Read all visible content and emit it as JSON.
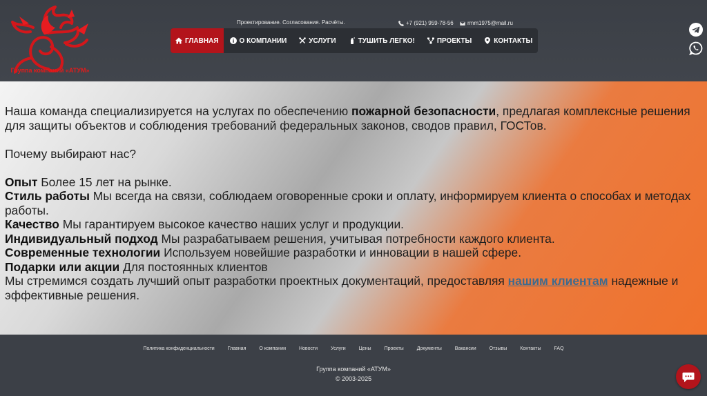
{
  "header": {
    "logo_caption": "Группа компаний «АТУМ»",
    "tagline": "Проектирование. Согласования. Расчёты.",
    "phone": "+7 (921) 959-78-56",
    "email": "rmm1975@mail.ru"
  },
  "nav": [
    {
      "label": "ГЛАВНАЯ",
      "icon": "home-icon"
    },
    {
      "label": "О КОМПАНИИ",
      "icon": "info-icon"
    },
    {
      "label": "УСЛУГИ",
      "icon": "tools-icon"
    },
    {
      "label": "ТУШИТЬ ЛЕГКО!",
      "icon": "extinguisher-icon"
    },
    {
      "label": "ПРОЕКТЫ",
      "icon": "sitemap-icon"
    },
    {
      "label": "КОНТАКТЫ",
      "icon": "map-pin-icon"
    }
  ],
  "colors": {
    "accent": "#b3141b",
    "orange": "#f0722c",
    "dark": "#3c4047",
    "link": "#3f6b8e"
  },
  "content": {
    "intro_1": "Наша команда специализируется на услугах по обеспечению ",
    "intro_bold": "пожарной безопасности",
    "intro_2": ", предлагая комплексные решения для защиты объектов и соблюдения требований федеральных законов, сводов правил, ГОСТов.",
    "why": "Почему выбирают нас?",
    "items": [
      {
        "title": "Опыт",
        "text": " Более 15 лет на рынке."
      },
      {
        "title": "Стиль работы",
        "text": " Мы всегда на связи, соблюдаем оговоренные сроки и оплату, информируем клиента о способах и методах работы."
      },
      {
        "title": "Качество",
        "text": " Мы гарантируем высокое качество наших услуг и продукции."
      },
      {
        "title": "Индивидуальный подход",
        "text": " Мы разрабатываем решения, учитывая потребности каждого клиента."
      },
      {
        "title": "Современные технологии",
        "text": " Используем новейшие разработки и инновации в нашей сфере."
      },
      {
        "title": "Подарки или акции",
        "text": " Для постоянных клиентов"
      }
    ],
    "closing_1": "Мы стремимся создать лучший опыт разработки проектных документаций, предоставляя ",
    "closing_link": "нашим клиентам",
    "closing_2": " надежные и эффективные решения."
  },
  "footer": {
    "links": [
      "Политика конфиденциальности",
      "Главная",
      "О компании",
      "Новости",
      "Услуги",
      "Цены",
      "Проекты",
      "Документы",
      "Вакансии",
      "Отзывы",
      "Контакты",
      "FAQ"
    ],
    "company": "Группа компаний «АТУМ»",
    "copyright": "© 2003-2025"
  }
}
